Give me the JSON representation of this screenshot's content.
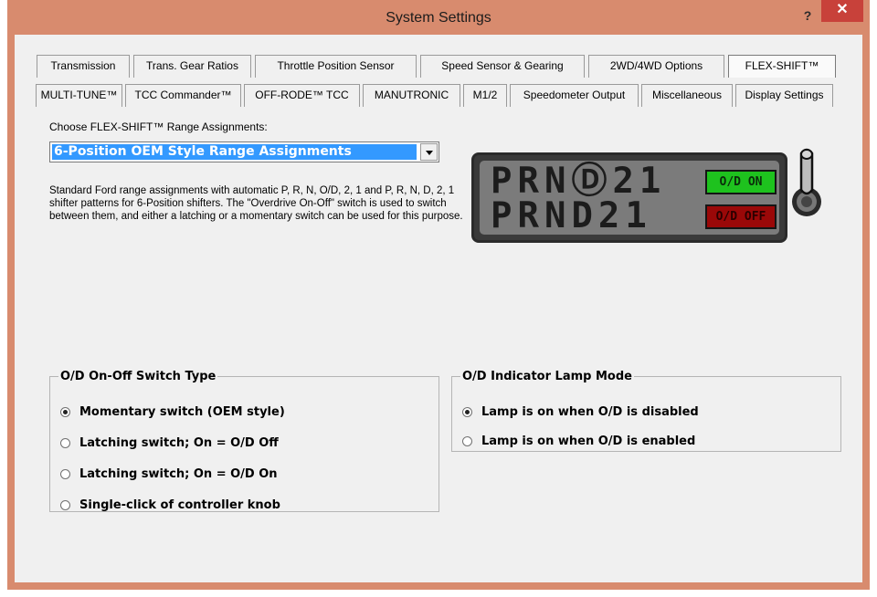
{
  "window": {
    "title": "System Settings",
    "help_label": "?",
    "close_label": "✕"
  },
  "tabs_row1": [
    "Transmission",
    "Trans. Gear Ratios",
    "Throttle Position Sensor",
    "Speed Sensor & Gearing",
    "2WD/4WD Options",
    "FLEX-SHIFT™"
  ],
  "tabs_row2": [
    "MULTI-TUNE™",
    "TCC Commander™",
    "OFF-RODE™ TCC",
    "MANUTRONIC",
    "M1/2",
    "Speedometer Output",
    "Miscellaneous",
    "Display Settings"
  ],
  "active_tab": "FLEX-SHIFT™",
  "range": {
    "label": "Choose FLEX-SHIFT™ Range Assignments:",
    "selected": "6-Position OEM Style Range Assignments",
    "description": "Standard Ford range assignments with automatic P, R, N, O/D, 2, 1 and P, R, N, D, 2, 1 shifter patterns for 6-Position shifters.  The \"Overdrive On-Off\" switch is used to switch between them, and either a latching or a momentary switch can be used for this purpose."
  },
  "display": {
    "line1": "PRNⒹ21",
    "line2": "PRND21",
    "lamp_on": "O/D ON",
    "lamp_off": "O/D OFF",
    "lamp_on_color": "#1ec21e",
    "lamp_off_color": "#9a0808"
  },
  "switch_type": {
    "legend": "O/D On-Off Switch Type",
    "options": [
      "Momentary switch (OEM style)",
      "Latching switch; On = O/D Off",
      "Latching switch; On = O/D On",
      "Single-click of controller knob"
    ],
    "selected_index": 0
  },
  "lamp_mode": {
    "legend": "O/D Indicator Lamp Mode",
    "options": [
      "Lamp is on when O/D is disabled",
      "Lamp is on when O/D is enabled"
    ],
    "selected_index": 0
  }
}
